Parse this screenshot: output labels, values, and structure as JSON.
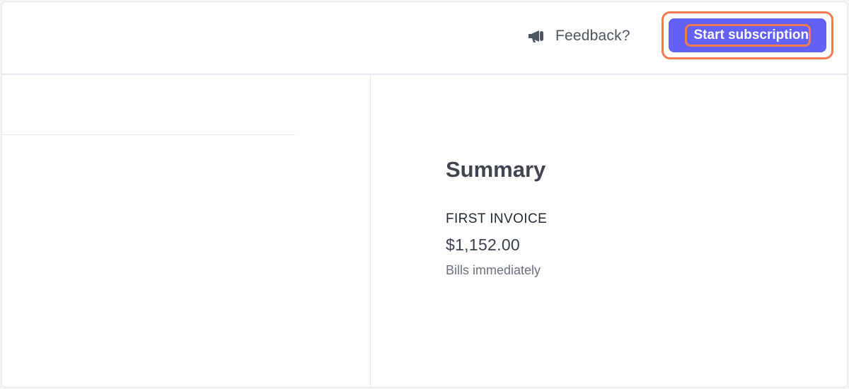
{
  "header": {
    "feedback_label": "Feedback?",
    "feedback_icon": "megaphone-icon",
    "start_button_label": "Start subscription"
  },
  "summary": {
    "title": "Summary",
    "first_invoice_label": "FIRST INVOICE",
    "first_invoice_amount": "$1,152.00",
    "billing_note": "Bills immediately"
  },
  "colors": {
    "accent": "#6360f5",
    "highlight": "#f47b4f",
    "text_primary": "#3f4550",
    "text_muted": "#6b7280"
  }
}
